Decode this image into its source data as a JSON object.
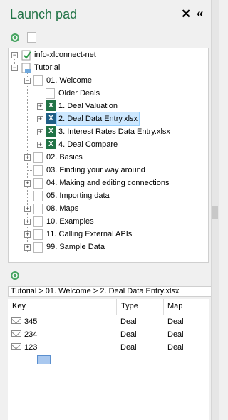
{
  "panel": {
    "title": "Launch pad",
    "close_glyph": "✕",
    "collapse_glyph": "«"
  },
  "toolbar": {
    "refresh_icon": "refresh-icon",
    "doc_icon": "document-icon"
  },
  "tree": {
    "nodes": [
      {
        "label": "info-xlconnect-net"
      },
      {
        "label": "Tutorial"
      },
      {
        "label": "01. Welcome"
      },
      {
        "label": "Older Deals"
      },
      {
        "label": "1. Deal Valuation"
      },
      {
        "label": "2. Deal Data Entry.xlsx"
      },
      {
        "label": "3. Interest Rates Data Entry.xlsx"
      },
      {
        "label": "4. Deal Compare"
      },
      {
        "label": "02. Basics"
      },
      {
        "label": "03. Finding your way around"
      },
      {
        "label": "04. Making and editing connections"
      },
      {
        "label": "05. Importing data"
      },
      {
        "label": "08. Maps"
      },
      {
        "label": "10. Examples"
      },
      {
        "label": "11. Calling External APIs"
      },
      {
        "label": "99. Sample Data"
      }
    ]
  },
  "breadcrumb": {
    "text": "Tutorial  >  01. Welcome  >  2. Deal Data Entry.xlsx"
  },
  "grid": {
    "headers": [
      "Key",
      "Type",
      "Map"
    ],
    "rows": [
      {
        "key": "345",
        "type": "Deal",
        "map": "Deal"
      },
      {
        "key": "234",
        "type": "Deal",
        "map": "Deal"
      },
      {
        "key": "123",
        "type": "Deal",
        "map": "Deal"
      }
    ]
  }
}
